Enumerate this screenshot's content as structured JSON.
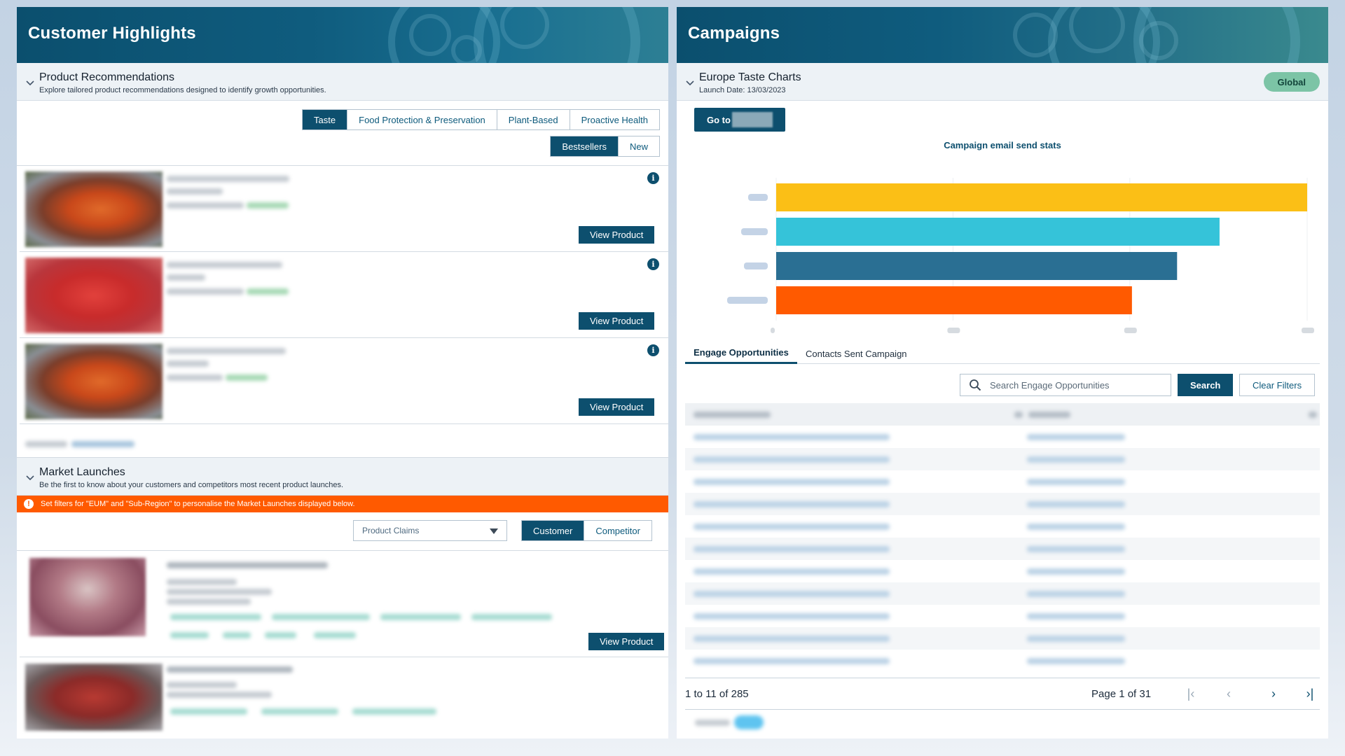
{
  "left": {
    "title": "Customer Highlights",
    "recommendations": {
      "title": "Product Recommendations",
      "subtitle": "Explore tailored product recommendations designed to identify growth opportunities.",
      "categories": [
        "Taste",
        "Food Protection & Preservation",
        "Plant-Based",
        "Proactive Health"
      ],
      "active_category": "Taste",
      "modes": [
        "Bestsellers",
        "New"
      ],
      "view_label": "View Product",
      "info_glyph": "i"
    },
    "launches": {
      "title": "Market Launches",
      "subtitle": "Be the first to know about your customers and competitors most recent product launches.",
      "alert": "Set filters for \"EUM\" and \"Sub-Region\" to personalise the Market Launches displayed below.",
      "alert_glyph": "!",
      "dropdown_placeholder": "Product Claims",
      "toggle": [
        "Customer",
        "Competitor"
      ],
      "view_label": "View Product"
    }
  },
  "right": {
    "title": "Campaigns",
    "campaign": {
      "name": "Europe Taste Charts",
      "launch_date": "Launch Date: 13/03/2023",
      "badge": "Global",
      "goto_label": "Go to"
    },
    "chart_data": {
      "type": "bar",
      "orientation": "horizontal",
      "title": "Campaign email send stats",
      "categories": [
        "",
        "",
        "",
        ""
      ],
      "values": [
        100,
        83.5,
        75.5,
        67
      ],
      "colors": [
        "#fbbf16",
        "#35c3d9",
        "#2a6f93",
        "#ff5a00"
      ],
      "xlim": [
        0,
        100
      ],
      "grid": true
    },
    "tabs": [
      "Engage Opportunities",
      "Contacts Sent Campaign"
    ],
    "active_tab": "Engage Opportunities",
    "search": {
      "placeholder": "Search Engage Opportunities",
      "button": "Search",
      "clear": "Clear Filters"
    },
    "pager": {
      "range": "1 to 11 of 285",
      "page": "Page 1 of 31",
      "first": "|‹",
      "prev": "‹",
      "next": "›",
      "last": "›|"
    }
  },
  "colors": {
    "primary": "#0d4f6e",
    "alert": "#ff5a00",
    "badge": "#7cc4a6"
  }
}
